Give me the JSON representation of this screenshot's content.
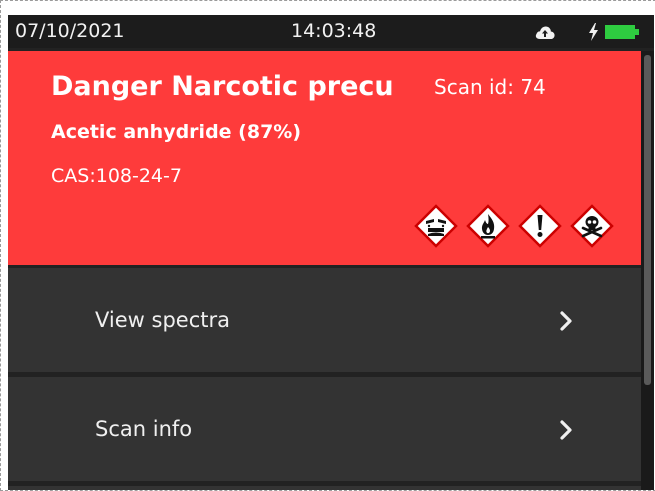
{
  "status_bar": {
    "date": "07/10/2021",
    "time": "14:03:48",
    "icons": [
      "cloud-upload-icon",
      "charging-bolt-icon",
      "battery-full-icon"
    ],
    "battery_color": "#2ecc40"
  },
  "result": {
    "title": "Danger Narcotic precu",
    "scan_id": "Scan id: 74",
    "compound": "Acetic anhydride (87%)",
    "cas": "CAS:108-24-7",
    "background_color": "#fe3b3b",
    "hazard_pictograms": [
      "corrosive-icon",
      "flammable-icon",
      "exclamation-icon",
      "toxic-skull-icon"
    ]
  },
  "menu": {
    "items": [
      {
        "label": "View spectra",
        "icon": "chevron-right-icon"
      },
      {
        "label": "Scan info",
        "icon": "chevron-right-icon"
      }
    ]
  }
}
